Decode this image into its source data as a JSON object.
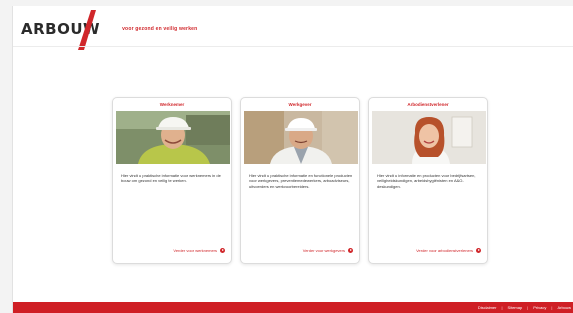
{
  "brand": {
    "logo_text": "ARBOUW",
    "tagline": "voor gezond en veilig werken",
    "accent_color": "#d0262a"
  },
  "cards": [
    {
      "title": "Werknemer",
      "body": "Hier vindt u praktische informatie voor werknemers in de bouw om gezond en veilig te werken.",
      "link": "Verder voor werknemers"
    },
    {
      "title": "Werkgever",
      "body": "Hier vindt u praktische informatie en functionele producten voor werkgevers, preventiemedewerkers, arboadviseurs, uitvoerders en werkvoorbereiders.",
      "link": "Verder voor werkgevers"
    },
    {
      "title": "Arbodienstverlener",
      "body": "Hier vindt u informatie en producten voor bedrijfsartsen, veiligheidskundigen, arbeidshygiënisten en A&O-deskundigen.",
      "link": "Verder voor arbodienstverleners"
    }
  ],
  "footer": {
    "links": [
      "Disclaimer",
      "Sitemap",
      "Privacy",
      "Arbouw"
    ],
    "color": "#cf1f25"
  }
}
